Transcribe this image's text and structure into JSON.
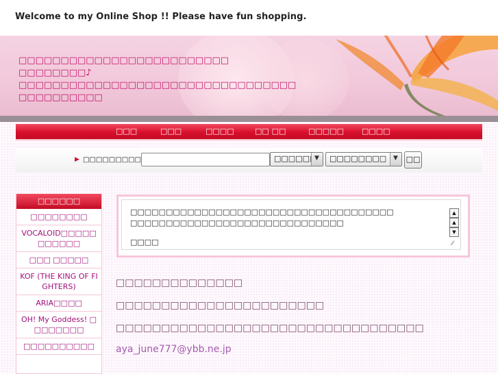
{
  "header": {
    "welcome": "Welcome to my Online Shop !! Please have fun shopping.",
    "hero_lines": [
      "□□□□□□□□□□□□□□□□□□□□□□□□□",
      "□□□□□□□□♪",
      "□□□□□□□□□□□□□□□□□□□□□□□□□□□□□□□□□",
      "□□□□□□□□□□"
    ]
  },
  "nav": {
    "items": [
      "□□□",
      "□□□",
      "□□□□",
      "□□ □□",
      "□□□□□",
      "□□□□"
    ]
  },
  "search": {
    "label": "□□□□□□□□□□□□□□□□",
    "input_value": "",
    "select1": "□□□□□□",
    "select2": "□□□□□□□□",
    "button": "□□"
  },
  "sidebar": {
    "heading": "□□□□□□",
    "items": [
      "□□□□□□□□",
      "VOCALOID□□□□□□□□□□□",
      "□□□ □□□□□",
      "KOF (THE KING OF FIGHTERS)",
      "ARIA□□□□",
      "OH! My Goddess! □□□□□□□□",
      "□□□□□□□□□□"
    ]
  },
  "notice": {
    "line1": "□□□□□□□□□□□□□□□□□□□□□□□□□□□□□□□□□□□□□",
    "line2": "□□□□□□□□□□□□□□□□□□□□□□□□□□□□□□",
    "line3": "□□□□"
  },
  "content": {
    "line1": "□□□□□□□□□□□□□□",
    "line2": "□□□□□□□□□□□□□□□□□□□□□□□",
    "line3": "□□□□□□□□□□□□□□□□□□□□□□□□□□□□□□□□□□",
    "email": "aya_june777@ybb.ne.jp"
  },
  "colors": {
    "accent_red": "#d8102d",
    "hero_text": "#c2126a",
    "link_purple": "#a45bb0"
  }
}
